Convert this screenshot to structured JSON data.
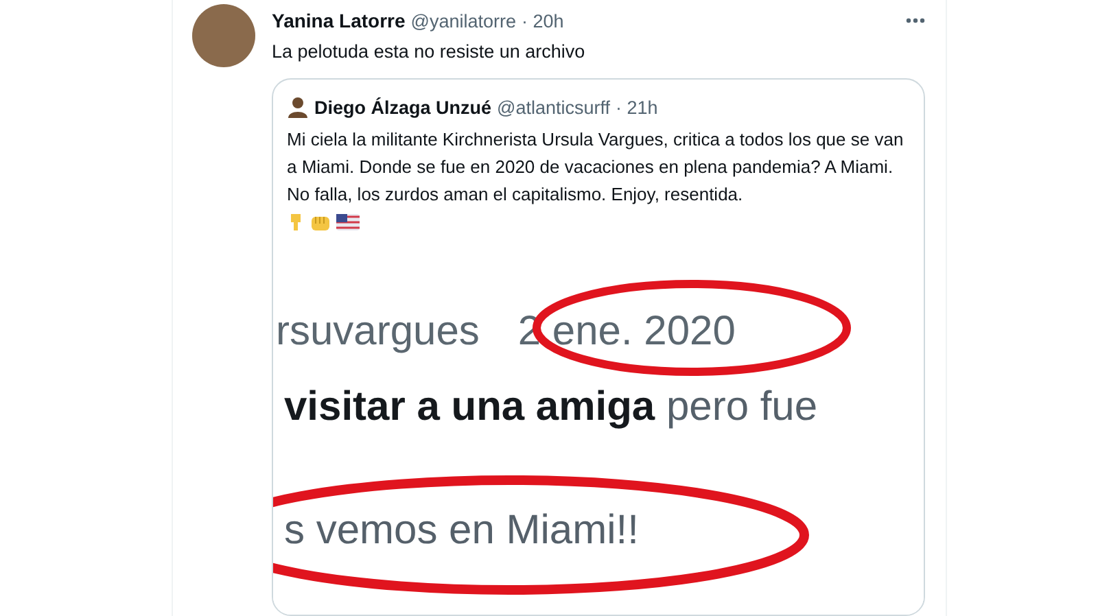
{
  "tweet": {
    "name": "Yanina Latorre",
    "handle": "@yanilatorre",
    "time": "· 20h",
    "text": "La pelotuda esta no resiste un archivo",
    "quoted": {
      "name": "Diego Álzaga Unzué",
      "handle": "@atlanticsurff",
      "time": "· 21h",
      "text": "Mi ciela la militante Kirchnerista Ursula Vargues, critica a todos los que se van a Miami. Donde se fue en 2020 de vacaciones en plena pandemia? A Miami. No falla, los zurdos aman el capitalismo. Enjoy, resentida.",
      "image": {
        "handle": "rsuvargues",
        "date": "2 ene. 2020",
        "line": "**visitar a una amiga** pero fue",
        "closing": "s vemos en Miami!!"
      }
    }
  }
}
